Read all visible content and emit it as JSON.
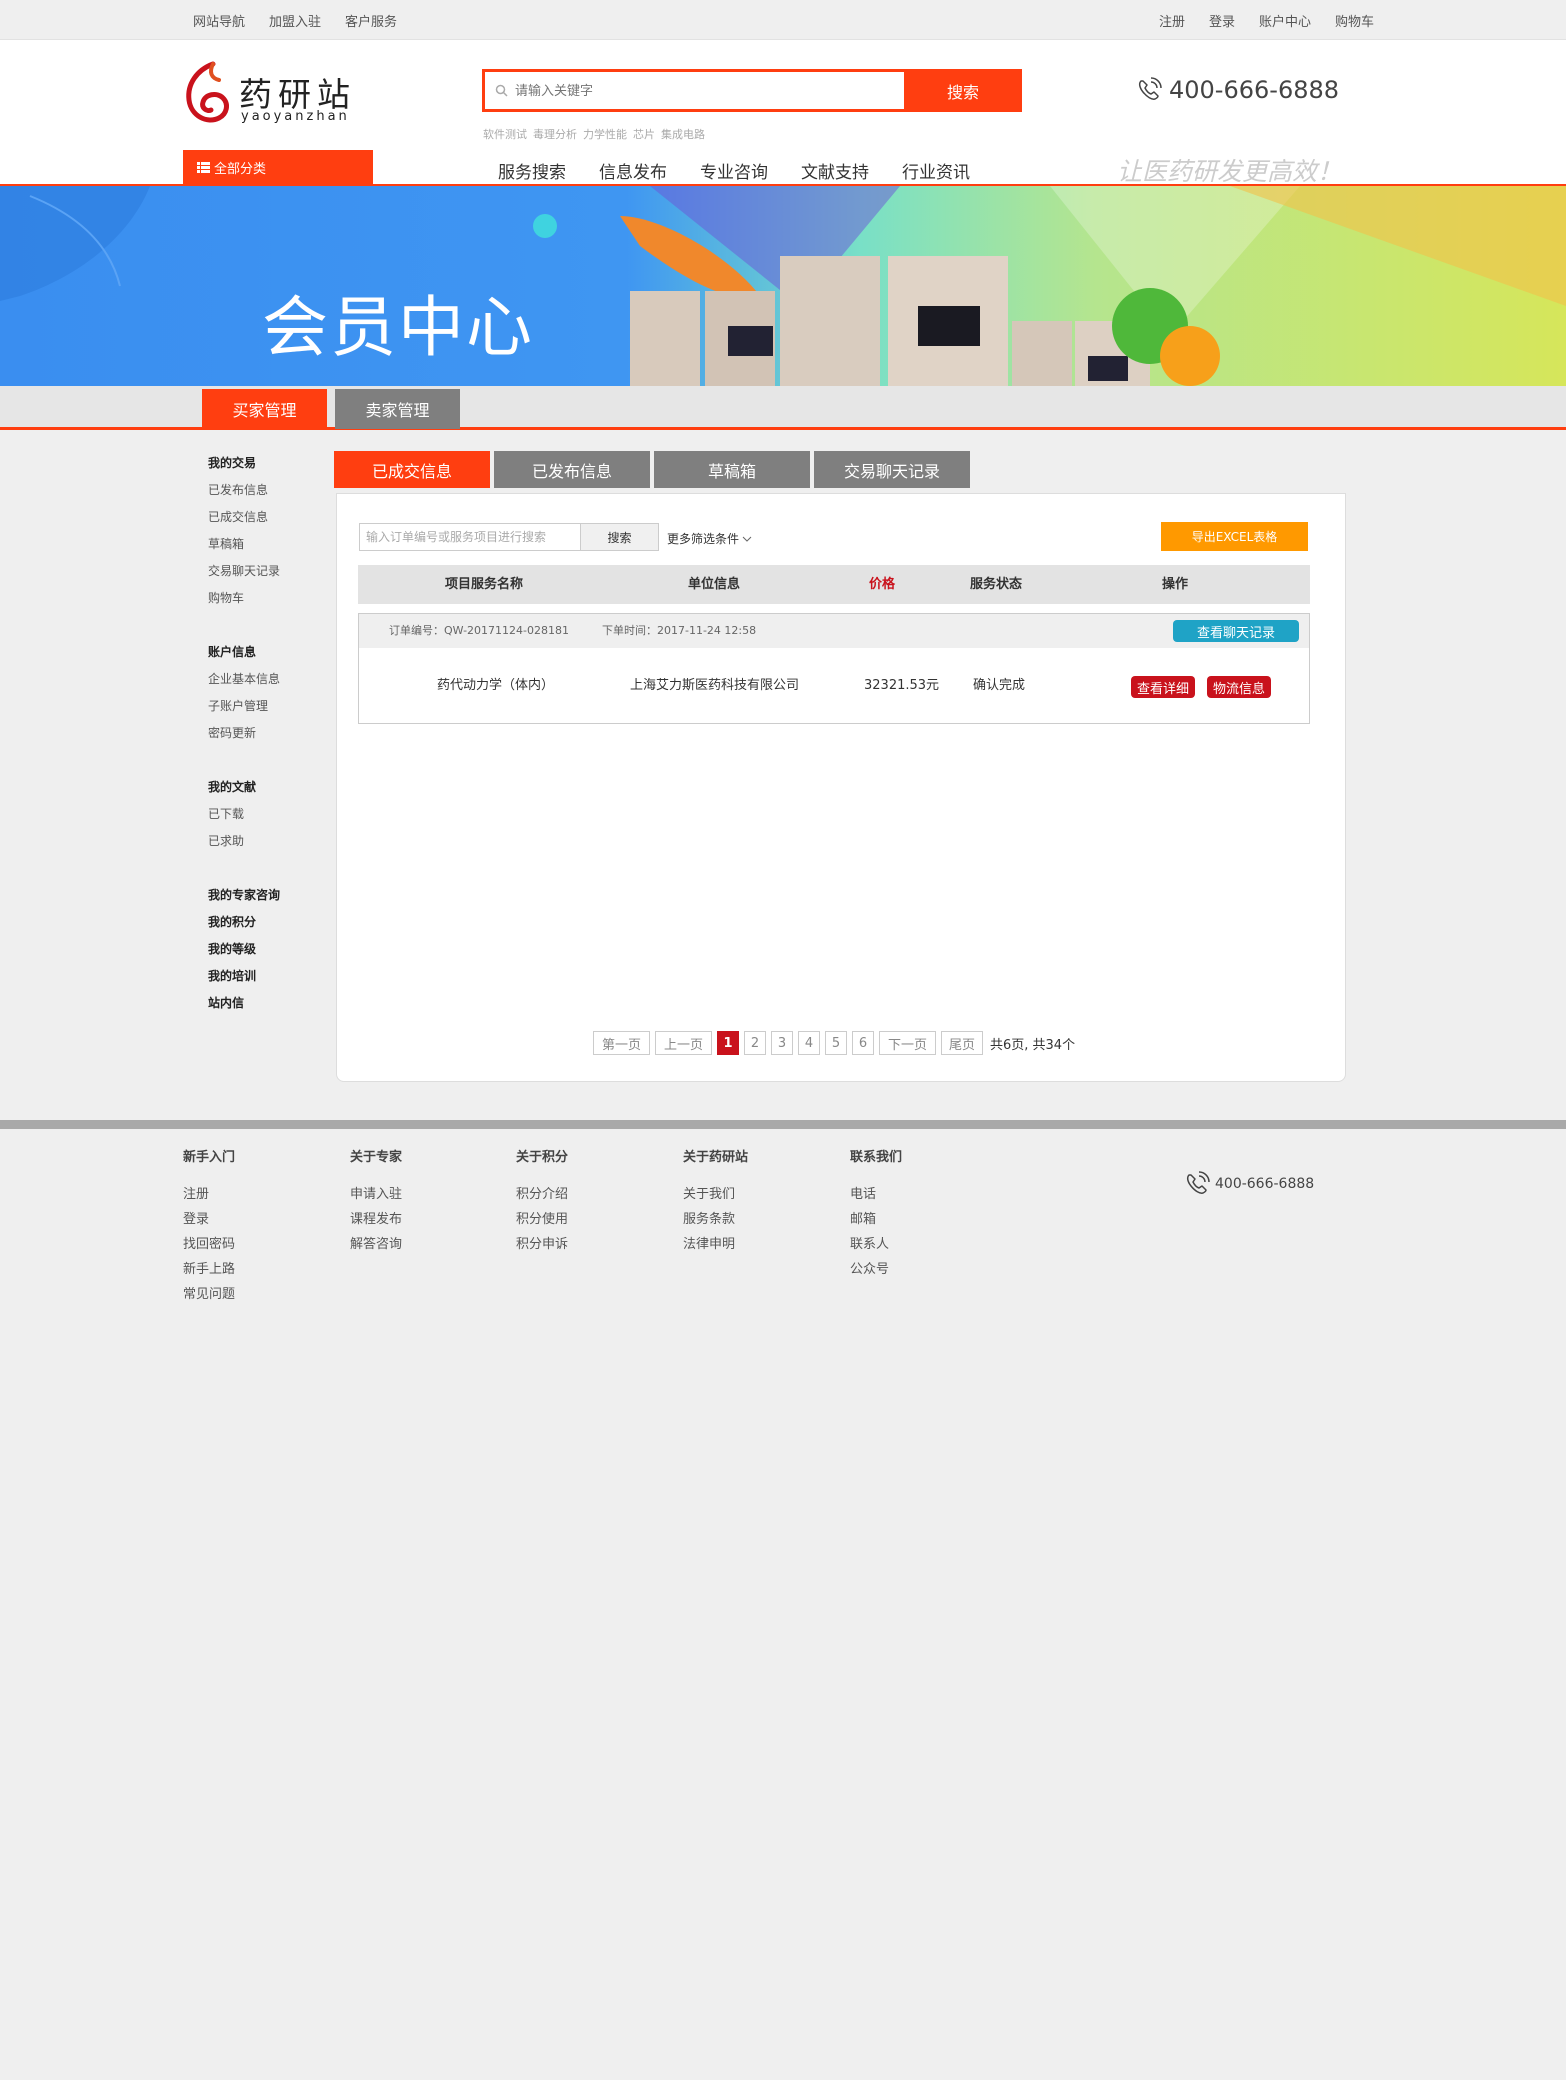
{
  "topbar": {
    "left_links": [
      "网站导航",
      "加盟入驻",
      "客户服务"
    ],
    "right_links": [
      "注册",
      "登录",
      "账户中心",
      "购物车"
    ]
  },
  "header": {
    "logo_cn": "药研站",
    "logo_en": "yaoyanzhan",
    "search_placeholder": "请输入关键字",
    "search_button": "搜索",
    "hot_words": [
      "软件测试",
      "毒理分析",
      "力学性能",
      "芯片",
      "集成电路"
    ],
    "phone": "400-666-6888",
    "category_button": "全部分类",
    "nav": [
      "服务搜索",
      "信息发布",
      "专业咨询",
      "文献支持",
      "行业资讯"
    ],
    "slogan": "让医药研发更高效！"
  },
  "banner": {
    "title": "会员中心"
  },
  "role_tabs": {
    "buyer": "买家管理",
    "seller": "卖家管理"
  },
  "sidebar": {
    "groups": [
      {
        "title": "我的交易",
        "items": [
          "已发布信息",
          "已成交信息",
          "草稿箱",
          "交易聊天记录",
          "购物车"
        ]
      },
      {
        "title": "账户信息",
        "items": [
          "企业基本信息",
          "子账户管理",
          "密码更新"
        ]
      },
      {
        "title": "我的文献",
        "items": [
          "已下载",
          "已求助"
        ]
      }
    ],
    "single_links": [
      "我的专家咨询",
      "我的积分",
      "我的等级",
      "我的培训",
      "站内信"
    ]
  },
  "content_tabs": [
    "已成交信息",
    "已发布信息",
    "草稿箱",
    "交易聊天记录"
  ],
  "filter": {
    "placeholder": "输入订单编号或服务项目进行搜索",
    "search_button": "搜索",
    "more": "更多筛选条件",
    "export_button": "导出EXCEL表格"
  },
  "table": {
    "headers": [
      "项目服务名称",
      "单位信息",
      "价格",
      "服务状态",
      "操作"
    ],
    "price_color": "#c9121c"
  },
  "order": {
    "number_label": "订单编号：",
    "number": "QW-20171124-028181",
    "time_label": "下单时间：",
    "time": "2017-11-24 12:58",
    "chat_button": "查看聊天记录",
    "project": "药代动力学（体内）",
    "unit": "上海艾力斯医药科技有限公司",
    "price": "32321.53元",
    "status": "确认完成",
    "detail_button": "查看详细",
    "logistics_button": "物流信息"
  },
  "pager": {
    "first": "第一页",
    "prev": "上一页",
    "pages": [
      "1",
      "2",
      "3",
      "4",
      "5",
      "6"
    ],
    "current": "1",
    "next": "下一页",
    "last": "尾页",
    "summary": "共6页, 共34个"
  },
  "footer": {
    "columns": [
      {
        "title": "新手入门",
        "items": [
          "注册",
          "登录",
          "找回密码",
          "新手上路",
          "常见问题"
        ]
      },
      {
        "title": "关于专家",
        "items": [
          "申请入驻",
          "课程发布",
          "解答咨询"
        ]
      },
      {
        "title": "关于积分",
        "items": [
          "积分介绍",
          "积分使用",
          "积分申诉"
        ]
      },
      {
        "title": "关于药研站",
        "items": [
          "关于我们",
          "服务条款",
          "法律申明"
        ]
      },
      {
        "title": "联系我们",
        "items": [
          "电话",
          "邮箱",
          "联系人",
          "公众号"
        ]
      }
    ],
    "phone": "400-666-6888"
  },
  "colors": {
    "accent": "#ff3e10",
    "orange": "#ff9900",
    "teal": "#1fa3c6",
    "red": "#c9121c",
    "grey_tab": "#7f7f7f"
  }
}
